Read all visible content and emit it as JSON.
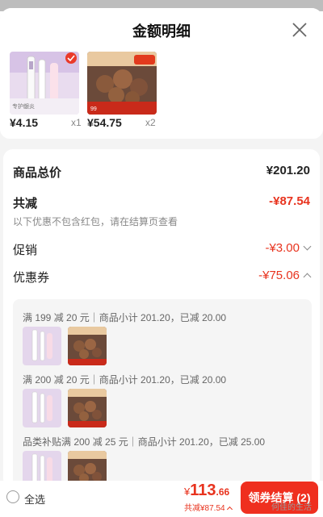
{
  "header": {
    "title": "金额明细"
  },
  "products": [
    {
      "price": "¥4.15",
      "qty": "x1",
      "image": "pink-electric-toothbrush"
    },
    {
      "price": "¥54.75",
      "qty": "x2",
      "image": "braised-meatballs"
    }
  ],
  "summary": {
    "total_label": "商品总价",
    "total_value": "¥201.20",
    "discount_label": "共减",
    "discount_value": "-¥87.54",
    "discount_note": "以下优惠不包含红包，请在结算页查看",
    "promo_label": "促销",
    "promo_value": "-¥3.00",
    "coupon_label": "优惠券",
    "coupon_value": "-¥75.06"
  },
  "coupons": [
    "满 199 减 20 元｜商品小计 201.20，已减 20.00",
    "满 200 减 20 元｜商品小计 201.20，已减 20.00",
    "品类补贴满 200 减 25 元｜商品小计 201.20，已减 25.00"
  ],
  "bottom_bar": {
    "select_all": "全选",
    "currency": "¥",
    "amount_int": "113",
    "amount_dec": ".66",
    "total_discount": "共减¥87.54",
    "checkout_label": "领券结算 (2)"
  },
  "watermark": "何佳的生活",
  "colors": {
    "accent_red": "#e8331e",
    "button_red": "#ef2f1f"
  }
}
